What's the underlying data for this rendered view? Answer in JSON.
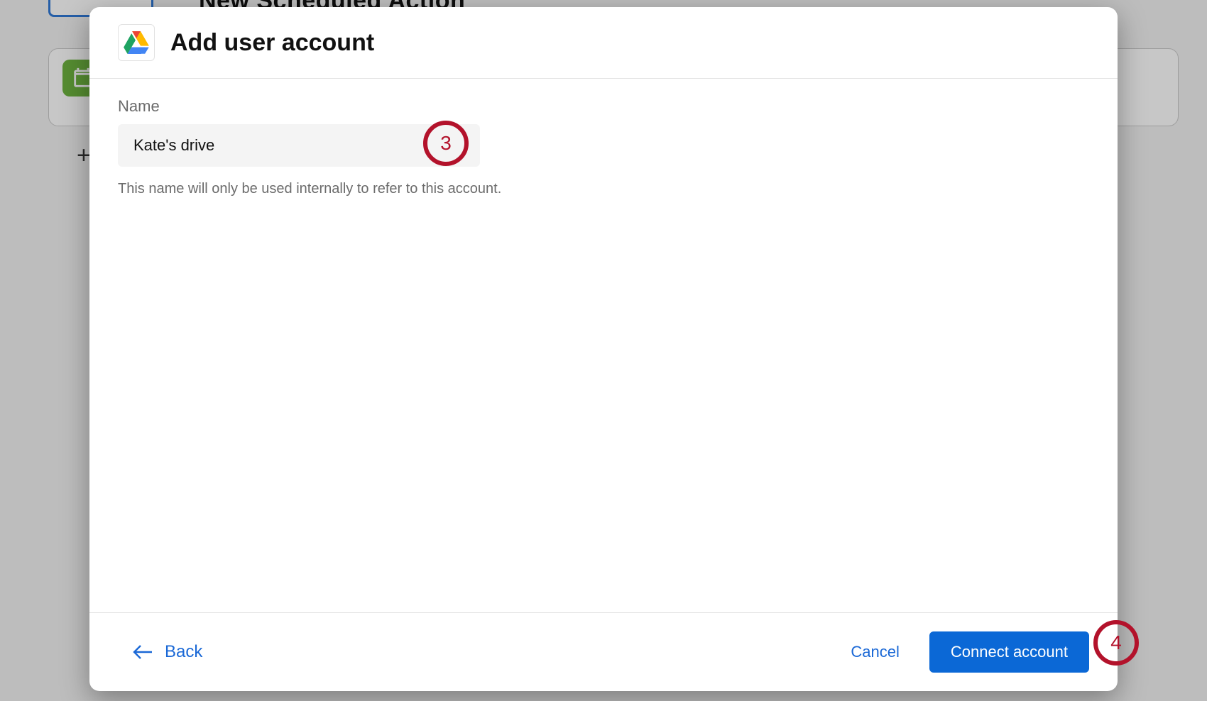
{
  "background": {
    "title_hint": "New Scheduled Action",
    "plus": "+"
  },
  "modal": {
    "title": "Add user account",
    "field_label": "Name",
    "name_value": "Kate's drive",
    "helper": "This name will only be used internally to refer to this account.",
    "back_label": "Back",
    "cancel_label": "Cancel",
    "connect_label": "Connect account"
  },
  "annotations": {
    "step3": "3",
    "step4": "4"
  }
}
